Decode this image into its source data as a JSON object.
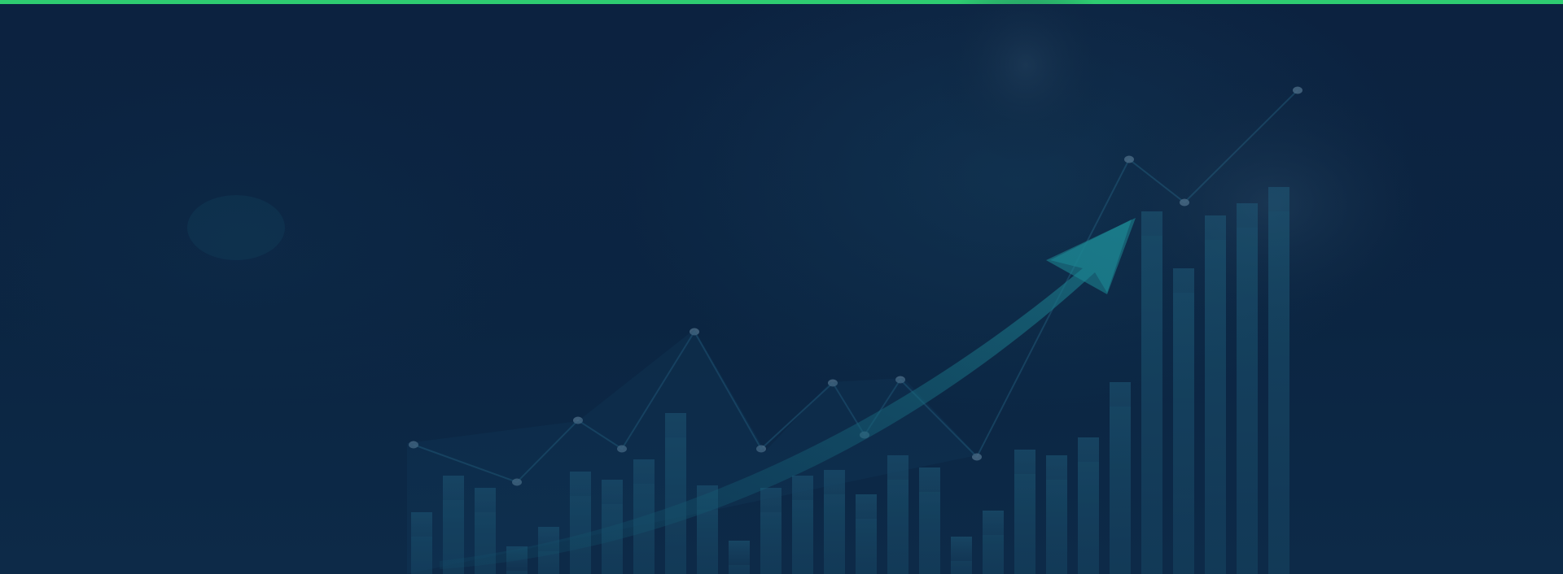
{
  "hero": {
    "accent_color": "#2ecc71",
    "background_color": "#0c223c",
    "background_image": "growth-chart-illustration"
  }
}
